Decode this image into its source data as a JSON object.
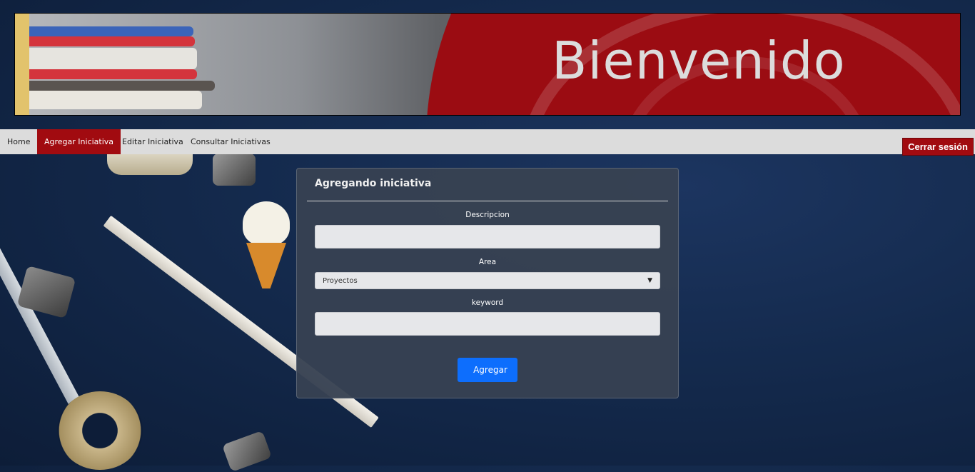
{
  "banner": {
    "title": "Bienvenido"
  },
  "nav": {
    "items": [
      {
        "label": "Home",
        "active": false
      },
      {
        "label": "Agregar Iniciativa",
        "active": true
      },
      {
        "label": "Editar Iniciativa",
        "active": false
      },
      {
        "label": "Consultar Iniciativas",
        "active": false
      }
    ],
    "logout_label": "Cerrar sesión"
  },
  "form": {
    "title": "Agregando iniciativa",
    "descripcion": {
      "label": "Descripcion",
      "value": ""
    },
    "area": {
      "label": "Area",
      "selected": "Proyectos"
    },
    "keyword": {
      "label": "keyword",
      "value": ""
    },
    "submit_label": "Agregar"
  },
  "colors": {
    "accent_red": "#a10b10",
    "primary_blue": "#0d6efd",
    "nav_bg": "#dcdcdc",
    "card_bg": "#374252"
  }
}
